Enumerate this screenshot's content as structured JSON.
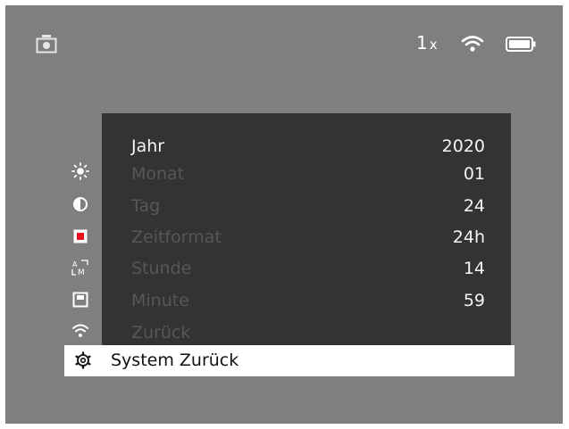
{
  "status": {
    "zoom": "1",
    "zoom_unit": "x"
  },
  "menu": {
    "rows": [
      {
        "label": "Jahr",
        "value": "2020",
        "active": true
      },
      {
        "label": "Monat",
        "value": "01",
        "active": false
      },
      {
        "label": "Tag",
        "value": "24",
        "active": false
      },
      {
        "label": "Zeitformat",
        "value": "24h",
        "active": false
      },
      {
        "label": "Stunde",
        "value": "14",
        "active": false
      },
      {
        "label": "Minute",
        "value": "59",
        "active": false
      },
      {
        "label": "Zurück",
        "value": "",
        "active": false
      }
    ]
  },
  "selected": {
    "label": "System Zurück"
  },
  "sidebar_icons": [
    "brightness-icon",
    "contrast-icon",
    "record-icon",
    "auto-manual-icon",
    "save-icon",
    "wifi-icon"
  ],
  "colors": {
    "background": "#7f7f7f",
    "menu": "#333333",
    "active_text": "#f4f4f4",
    "inactive_text": "#575757"
  }
}
